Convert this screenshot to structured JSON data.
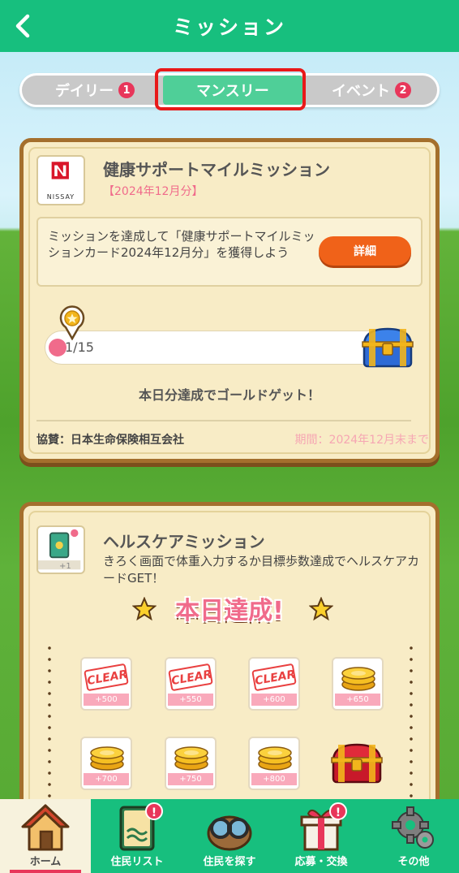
{
  "header": {
    "title": "ミッション"
  },
  "tabs": [
    {
      "label": "デイリー",
      "badge": "1"
    },
    {
      "label": "マンスリー",
      "badge": ""
    },
    {
      "label": "イベント",
      "badge": "2"
    }
  ],
  "mission1": {
    "logo_text": "NISSAY",
    "title": "健康サポートマイルミッション",
    "period": "【2024年12月分】",
    "description": "ミッションを達成して「健康サポートマイルミッションカード2024年12月分」を獲得しよう",
    "detail_button": "詳細",
    "progress_text": "1/15",
    "progress_fraction": 0.067,
    "gold_message": "本日分達成でゴールドゲット！",
    "sponsor": "協賛：日本生命保険相互会社",
    "period_end": "期間：2024年12月末まで"
  },
  "mission2": {
    "icon_caption": "+1",
    "title": "ヘルスケアミッション",
    "description": "きろく画面で体重入力するか目標歩数達成でヘルスケアカードGET！",
    "achieved_banner": "本日達成!",
    "rewards": [
      {
        "label": "+500",
        "cleared": true,
        "stamp": "CLEAR"
      },
      {
        "label": "+550",
        "cleared": true,
        "stamp": "CLEAR"
      },
      {
        "label": "+600",
        "cleared": true,
        "stamp": "CLEAR"
      },
      {
        "label": "+650",
        "cleared": false,
        "stamp": ""
      },
      {
        "label": "+700",
        "cleared": false,
        "stamp": ""
      },
      {
        "label": "+750",
        "cleared": false,
        "stamp": ""
      },
      {
        "label": "+800",
        "cleared": false,
        "stamp": ""
      }
    ]
  },
  "bottom_nav": [
    {
      "label": "ホーム",
      "icon": "house-icon",
      "badge": ""
    },
    {
      "label": "住民リスト",
      "icon": "book-icon",
      "badge": "!"
    },
    {
      "label": "住民を探す",
      "icon": "binoculars-icon",
      "badge": ""
    },
    {
      "label": "応募・交換",
      "icon": "gift-icon",
      "badge": "!"
    },
    {
      "label": "その他",
      "icon": "gear-icon",
      "badge": ""
    }
  ],
  "colors": {
    "header_green": "#17bf7e",
    "tab_active": "#4fcf98",
    "highlight_red": "#e81919",
    "accent_pink": "#f06b8b",
    "detail_orange": "#f06219",
    "card_bg": "#f8ecc6",
    "card_border": "#a46f2d"
  }
}
